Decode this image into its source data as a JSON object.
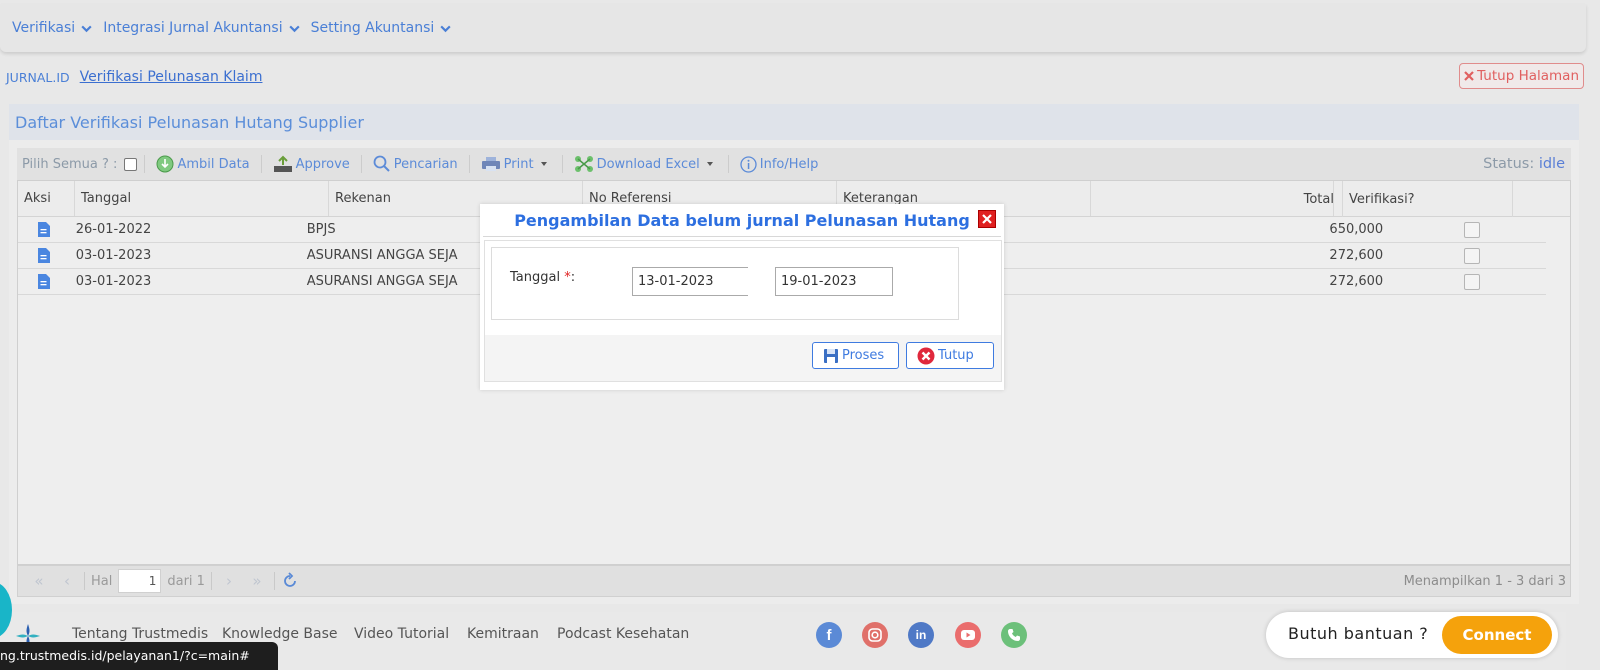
{
  "nav": {
    "items": [
      {
        "label": "Verifikasi"
      },
      {
        "label": "Integrasi Jurnal Akuntansi"
      },
      {
        "label": "Setting Akuntansi"
      }
    ]
  },
  "breadcrumb": {
    "home": "JURNAL.ID",
    "tab": "Verifikasi Pelunasan Klaim",
    "close_label": "Tutup Halaman"
  },
  "panel": {
    "title": "Daftar Verifikasi Pelunasan Hutang Supplier"
  },
  "toolbar": {
    "select_all": "Pilih Semua ? :",
    "ambil_data": "Ambil Data",
    "approve": "Approve",
    "pencarian": "Pencarian",
    "print": "Print",
    "download_excel": "Download Excel",
    "info_help": "Info/Help",
    "status_label": "Status:",
    "status_value": "idle"
  },
  "grid": {
    "columns": [
      "Aksi",
      "Tanggal",
      "Rekenan",
      "No Referensi",
      "Keterangan",
      "",
      "Total",
      "Verifikasi?"
    ],
    "rows": [
      {
        "tanggal": "26-01-2022",
        "rekenan": "BPJS",
        "total": "650,000"
      },
      {
        "tanggal": "03-01-2023",
        "rekenan": "ASURANSI ANGGA SEJA",
        "total": "272,600"
      },
      {
        "tanggal": "03-01-2023",
        "rekenan": "ASURANSI ANGGA SEJA",
        "total": "272,600"
      }
    ]
  },
  "pager": {
    "hal_label": "Hal",
    "page": "1",
    "of_label": "dari 1",
    "info": "Menampilkan 1 - 3 dari 3"
  },
  "dialog": {
    "title": "Pengambilan Data belum jurnal Pelunasan Hutang",
    "tanggal_label": "Tanggal",
    "required_mark": "*",
    "colon": ":",
    "date_from": "13-01-2023",
    "date_to": "19-01-2023",
    "proses_label": "Proses",
    "tutup_label": "Tutup"
  },
  "footer": {
    "links": [
      "Tentang Trustmedis",
      "Knowledge Base",
      "Video Tutorial",
      "Kemitraan",
      "Podcast Kesehatan"
    ],
    "help_text": "Butuh bantuan ?",
    "connect_label": "Connect",
    "status_url": "ng.trustmedis.id/pelayanan1/?c=main#",
    "social": [
      {
        "icon": "facebook-icon",
        "color": "#5b8ad6"
      },
      {
        "icon": "instagram-icon",
        "color": "#e0706a"
      },
      {
        "icon": "linkedin-icon",
        "color": "#4f79c6"
      },
      {
        "icon": "youtube-icon",
        "color": "#ea6d6d"
      },
      {
        "icon": "phone-icon",
        "color": "#6cc07a"
      }
    ]
  }
}
